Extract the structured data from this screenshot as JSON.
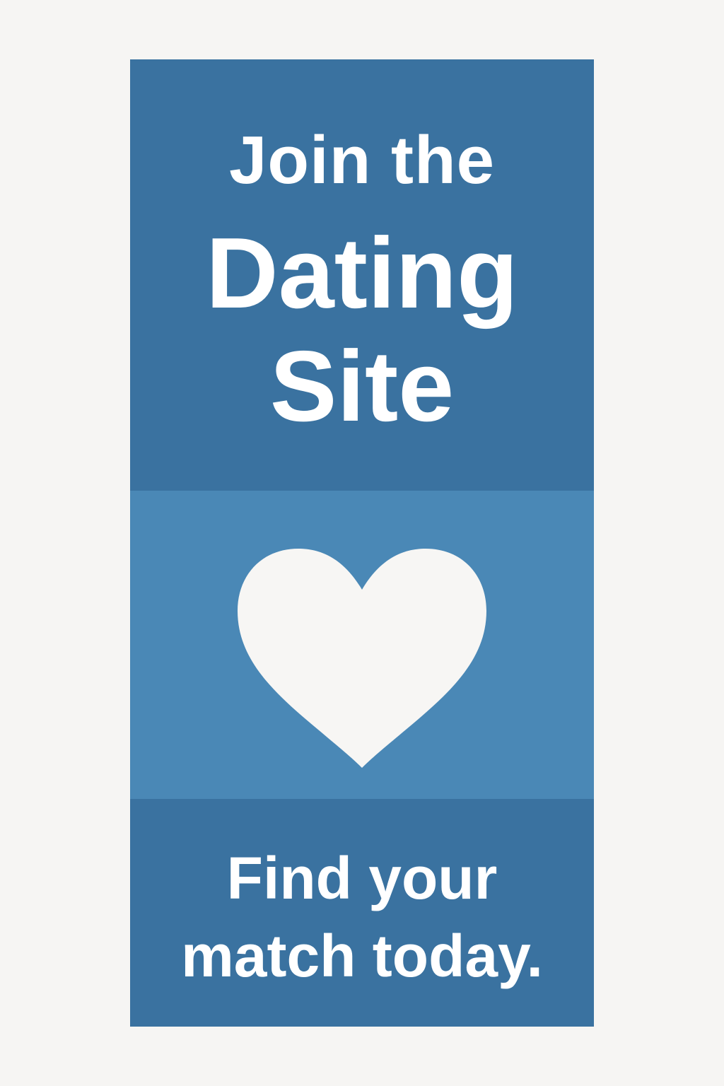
{
  "banner": {
    "headline": {
      "line_1": "Join the",
      "line_2": "Dating",
      "line_3": "Site"
    },
    "icon": "heart-icon",
    "tagline": {
      "line_1": "Find your",
      "line_2": "match today."
    },
    "colors": {
      "background": "#f6f5f3",
      "panel_dark": "#3a72a0",
      "panel_light": "#4a88b6",
      "text": "#ffffff"
    }
  }
}
